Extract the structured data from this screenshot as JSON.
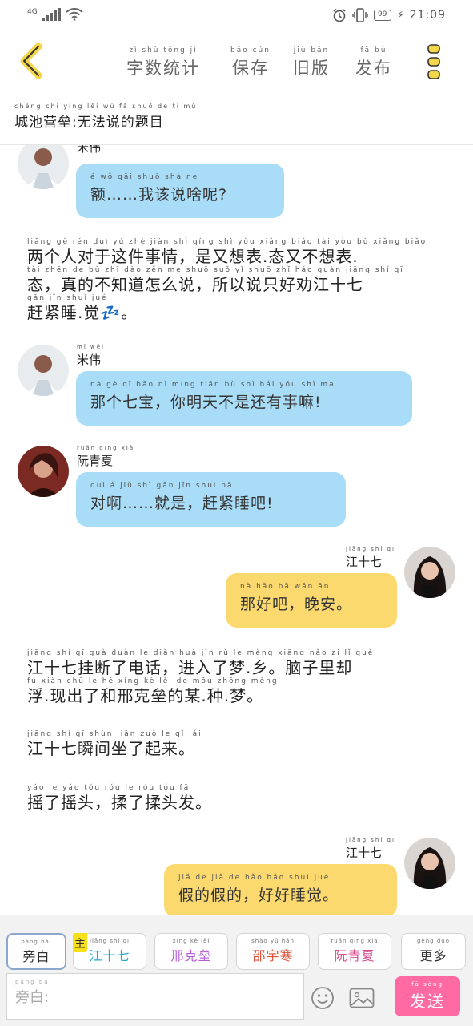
{
  "status_bar": {
    "network": "4G",
    "battery": "99",
    "time": "21:09"
  },
  "top_bar": {
    "actions": [
      {
        "pinyin": "zì shù tǒng jì",
        "label": "字数统计"
      },
      {
        "pinyin": "bǎo cún",
        "label": "保存"
      },
      {
        "pinyin": "jiù bǎn",
        "label": "旧版"
      },
      {
        "pinyin": "fā bù",
        "label": "发布"
      }
    ]
  },
  "story": {
    "title_pinyin": "chéng chí yíng lěi    wú fǎ shuō de tí mù",
    "title": "城池营垒:无法说的题目"
  },
  "messages": [
    {
      "speaker": "米伟",
      "speaker_pinyin": "",
      "pinyin": "é        wǒ gāi shuō shà ne",
      "text": "额……我该说啥呢?"
    },
    {
      "narration": [
        {
          "pinyin": "liǎng gè rén duì yú zhè jiàn shì qíng    shì yòu xiǎng biǎo tài yòu bù xiǎng biǎo",
          "text": "两个人对于这件事情，是又想表.态又不想表."
        },
        {
          "pinyin": "tài  zhēn de bù zhī dào zěn me shuō  suǒ yǐ shuō zhǐ hǎo quàn jiāng shí qī",
          "text": "态，真的不知道怎么说，所以说只好劝江十七"
        },
        {
          "pinyin": "gǎn jǐn shuì jué",
          "text": "赶紧睡.觉💤。"
        }
      ]
    },
    {
      "speaker": "米伟",
      "speaker_pinyin": "mǐ wěi",
      "pinyin": "nà gè qī bǎo    nǐ míng tiān bù shì hái yǒu shì ma",
      "text": "那个七宝，你明天不是还有事嘛!"
    },
    {
      "speaker": "阮青夏",
      "speaker_pinyin": "ruǎn qīng xià",
      "pinyin": "duì á       jiù shì    gǎn jǐn shuì bā",
      "text": "对啊……就是，赶紧睡吧!"
    },
    {
      "speaker": "江十七",
      "speaker_pinyin": "jiāng shí qī",
      "pinyin": "nà hǎo bā     wǎn ān",
      "text": "那好吧，晚安。"
    },
    {
      "narration": [
        {
          "pinyin": "jiāng shí qī guà duàn le diàn huà   jìn rù le mèng xiāng   nǎo zi lǐ què",
          "text": "江十七挂断了电话，进入了梦.乡。脑子里却"
        },
        {
          "pinyin": "fú xiàn chū le hé xíng kè lěi de mǒu zhǒng mèng",
          "text": "浮.现出了和邢克垒的某.种.梦。"
        }
      ]
    },
    {
      "narration": [
        {
          "pinyin": "jiāng shí qī shùn jiān zuò le qǐ lái",
          "text": "江十七瞬间坐了起来。"
        }
      ]
    },
    {
      "narration": [
        {
          "pinyin": "yáo le yáo tóu   róu le róu tóu fā",
          "text": "摇了摇头，揉了揉头发。"
        }
      ]
    },
    {
      "speaker": "江十七",
      "speaker_pinyin": "jiāng shí qī",
      "pinyin": "jiǎ de jiǎ de     hǎo hǎo shuì jué",
      "text": "假的假的，好好睡觉。"
    }
  ],
  "partial_name_top": "米伟",
  "characters": [
    {
      "pinyin": "páng bái",
      "label": "旁白",
      "color": "#333333"
    },
    {
      "pinyin": "jiāng shí qī",
      "label": "江十七",
      "color": "#2aa6c9",
      "badge": "主",
      "badge_pinyin": "zhǔ"
    },
    {
      "pinyin": "xíng kè lěi",
      "label": "邢克垒",
      "color": "#b45bd6"
    },
    {
      "pinyin": "shào yǔ hán",
      "label": "邵宇寒",
      "color": "#e0503a"
    },
    {
      "pinyin": "ruǎn qīng xià",
      "label": "阮青夏",
      "color": "#d84a8c"
    },
    {
      "pinyin": "gèng duō",
      "label": "更多",
      "color": "#333333"
    }
  ],
  "input": {
    "pinyin": "páng bái",
    "placeholder": "旁白:"
  },
  "send": {
    "pinyin": "fā sòng",
    "label": "发送"
  },
  "colors": {
    "accent_yellow": "#fbd96e",
    "bubble_blue": "#a9dcf7",
    "send_pink": "#ff6aa2"
  }
}
